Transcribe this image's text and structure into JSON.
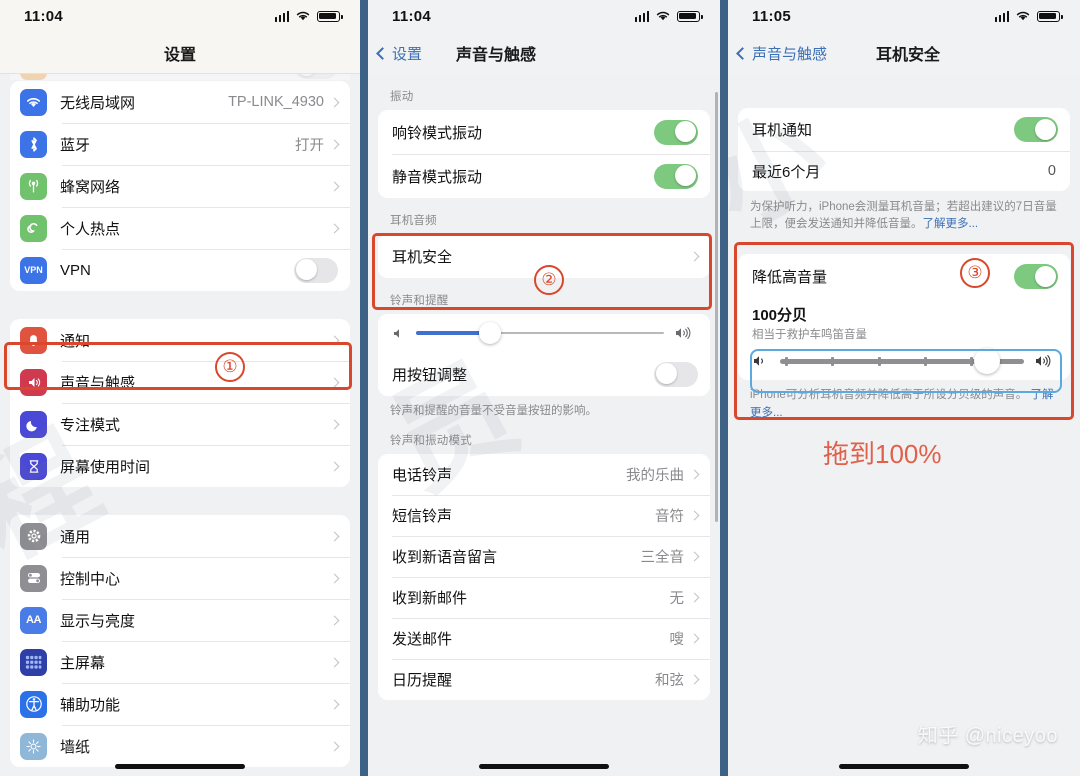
{
  "panels": [
    {
      "id": "settings",
      "status": {
        "time": "11:04"
      },
      "nav": {
        "title": "设置"
      },
      "partial_row_hint": "airplane-mode",
      "groups": [
        {
          "rows": [
            {
              "icon": "wifi-icon",
              "label": "无线局域网",
              "value": "TP-LINK_4930",
              "accessory": "chevron"
            },
            {
              "icon": "bluetooth-icon",
              "label": "蓝牙",
              "value": "打开",
              "accessory": "chevron"
            },
            {
              "icon": "cellular-icon",
              "label": "蜂窝网络",
              "value": "",
              "accessory": "chevron"
            },
            {
              "icon": "hotspot-icon",
              "label": "个人热点",
              "value": "",
              "accessory": "chevron"
            },
            {
              "icon": "vpn-icon",
              "label": "VPN",
              "value": "",
              "accessory": "toggle-off"
            }
          ]
        },
        {
          "rows": [
            {
              "icon": "notifications-icon",
              "label": "通知",
              "value": "",
              "accessory": "chevron"
            },
            {
              "icon": "sounds-haptics-icon",
              "label": "声音与触感",
              "value": "",
              "accessory": "chevron",
              "highlighted": true
            },
            {
              "icon": "focus-icon",
              "label": "专注模式",
              "value": "",
              "accessory": "chevron"
            },
            {
              "icon": "screen-time-icon",
              "label": "屏幕使用时间",
              "value": "",
              "accessory": "chevron"
            }
          ]
        },
        {
          "rows": [
            {
              "icon": "general-icon",
              "label": "通用",
              "value": "",
              "accessory": "chevron"
            },
            {
              "icon": "control-center-icon",
              "label": "控制中心",
              "value": "",
              "accessory": "chevron"
            },
            {
              "icon": "display-brightness-icon",
              "label": "显示与亮度",
              "value": "",
              "accessory": "chevron"
            },
            {
              "icon": "home-screen-icon",
              "label": "主屏幕",
              "value": "",
              "accessory": "chevron"
            },
            {
              "icon": "accessibility-icon",
              "label": "辅助功能",
              "value": "",
              "accessory": "chevron"
            },
            {
              "icon": "wallpaper-icon",
              "label": "墙纸",
              "value": "",
              "accessory": "chevron"
            }
          ]
        }
      ],
      "annotation": {
        "number": "①"
      }
    },
    {
      "id": "sounds-haptics",
      "status": {
        "time": "11:04"
      },
      "nav": {
        "back": "设置",
        "title": "声音与触感"
      },
      "sections": [
        {
          "header": "振动",
          "rows": [
            {
              "label": "响铃模式振动",
              "accessory": "toggle-on"
            },
            {
              "label": "静音模式振动",
              "accessory": "toggle-on"
            }
          ]
        },
        {
          "header": "耳机音频",
          "highlighted": true,
          "rows": [
            {
              "label": "耳机安全",
              "accessory": "chevron"
            }
          ]
        },
        {
          "header": "铃声和提醒",
          "slider": {
            "value_percent": 30
          },
          "rows": [
            {
              "label": "用按钮调整",
              "accessory": "toggle-off"
            }
          ],
          "note": "铃声和提醒的音量不受音量按钮的影响。"
        },
        {
          "header": "铃声和振动模式",
          "rows": [
            {
              "label": "电话铃声",
              "value": "我的乐曲",
              "accessory": "chevron"
            },
            {
              "label": "短信铃声",
              "value": "音符",
              "accessory": "chevron"
            },
            {
              "label": "收到新语音留言",
              "value": "三全音",
              "accessory": "chevron"
            },
            {
              "label": "收到新邮件",
              "value": "无",
              "accessory": "chevron"
            },
            {
              "label": "发送邮件",
              "value": "嗖",
              "accessory": "chevron"
            },
            {
              "label": "日历提醒",
              "value": "和弦",
              "accessory": "chevron"
            }
          ]
        }
      ],
      "annotation": {
        "number": "②"
      }
    },
    {
      "id": "headphone-safety",
      "status": {
        "time": "11:05"
      },
      "nav": {
        "back": "声音与触感",
        "title": "耳机安全"
      },
      "sections": [
        {
          "rows": [
            {
              "label": "耳机通知",
              "accessory": "toggle-on"
            },
            {
              "label": "最近6个月",
              "value": "0",
              "accessory": "none"
            }
          ],
          "note": "为保护听力，iPhone会测量耳机音量；若超出建议的7日音量上限，便会发送通知并降低音量。",
          "note_link": "了解更多..."
        },
        {
          "highlighted": true,
          "rows": [
            {
              "label": "降低高音量",
              "accessory": "toggle-on"
            }
          ],
          "decibel": {
            "value": "100分贝",
            "subtitle": "相当于救护车鸣笛音量"
          },
          "slider": {
            "value_percent": 85,
            "ticks": 5
          },
          "note": "iPhone可分析耳机音频并降低高于所设分贝级的声音。",
          "note_link": "了解更多..."
        }
      ],
      "annotation": {
        "number": "③",
        "callout": "拖到100%"
      }
    }
  ],
  "watermarks": {
    "big": "程序员小",
    "credit": "知乎 @niceyoo"
  },
  "colors": {
    "accent_red": "#d9472c",
    "annotation_red": "#e0604a",
    "link_blue": "#3c6fb4",
    "toggle_green": "#7dc97f",
    "slider_blue": "#3f6fd0",
    "panel_bg": "#f0f1f3",
    "divider": "#3d6286"
  }
}
